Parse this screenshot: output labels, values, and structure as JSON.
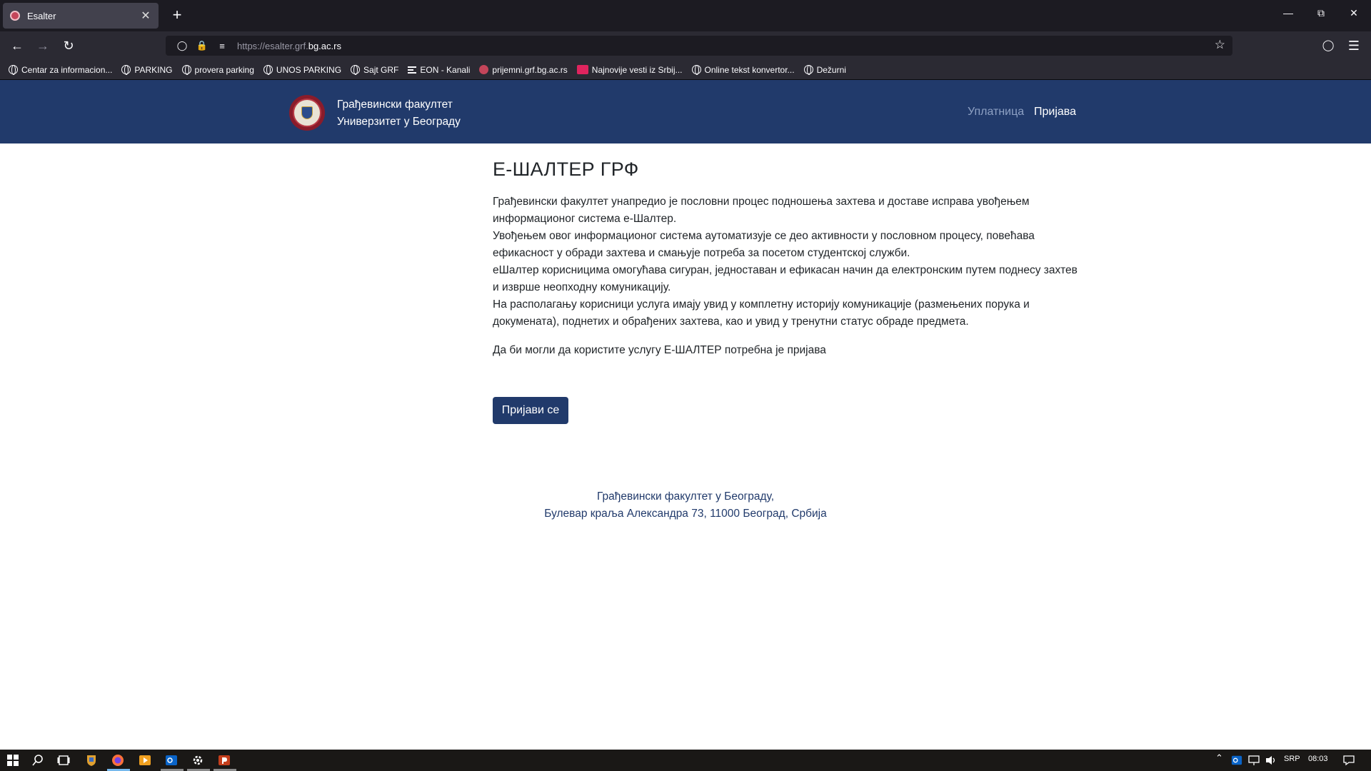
{
  "browser": {
    "tab_title": "Esalter",
    "tab_close": "✕",
    "new_tab": "+",
    "url_prefix": "https://esalter.grf.",
    "url_domain": "bg.ac.rs",
    "bookmarks": [
      {
        "label": "Centar za informacion...",
        "icon": "globe-icon"
      },
      {
        "label": "PARKING",
        "icon": "globe-icon"
      },
      {
        "label": "provera parking",
        "icon": "globe-icon"
      },
      {
        "label": "UNOS PARKING",
        "icon": "globe-icon"
      },
      {
        "label": "Sajt GRF",
        "icon": "globe-icon"
      },
      {
        "label": "EON - Kanali",
        "icon": "list-icon"
      },
      {
        "label": "prijemni.grf.bg.ac.rs",
        "icon": "grf-favicon"
      },
      {
        "label": "Najnovije vesti iz Srbij...",
        "icon": "news-favicon"
      },
      {
        "label": "Online tekst konvertor...",
        "icon": "globe-icon"
      },
      {
        "label": "Dežurni",
        "icon": "globe-icon"
      }
    ]
  },
  "site": {
    "brand_line1": "Грађевински факултет",
    "brand_line2": "Универзитет у Београду",
    "nav_payment": "Уплатница",
    "nav_login": "Пријава"
  },
  "main": {
    "title": "Е-ШАЛТЕР ГРФ",
    "paragraphs": [
      "Грађевински факултет унапредио је пословни процес подношења захтева и доставе исправа увођењем информационог система е-Шалтер.",
      "Увођењем овог информационог система аутоматизује се део активности у пословном процесу, повећава ефикасност у обради захтева и смањује потреба за посетом студентској служби.",
      "еШалтер корисницима омогућава сигуран, једноставан и ефикасан начин да електронским путем поднесу захтев и изврше неопходну комуникацију.",
      "На располагању корисници услуга имају увид у комплетну историју комуникације (размењених порука и докумената), поднетих и обрађених захтева, као и увид у тренутни статус обраде предмета."
    ],
    "login_note": "Да би могли да користите услугу Е-ШАЛТЕР потребна је пријава",
    "login_button": "Пријави се"
  },
  "footer": {
    "line1": "Грађевински факултет у Београду,",
    "line2": "Булевар краља Александра 73, 11000 Београд, Србија"
  },
  "taskbar": {
    "language": "SRP",
    "time": "08:03"
  },
  "colors": {
    "header_bg": "#213a6b",
    "accent": "#213a6b",
    "browser_dark": "#1c1b22"
  }
}
